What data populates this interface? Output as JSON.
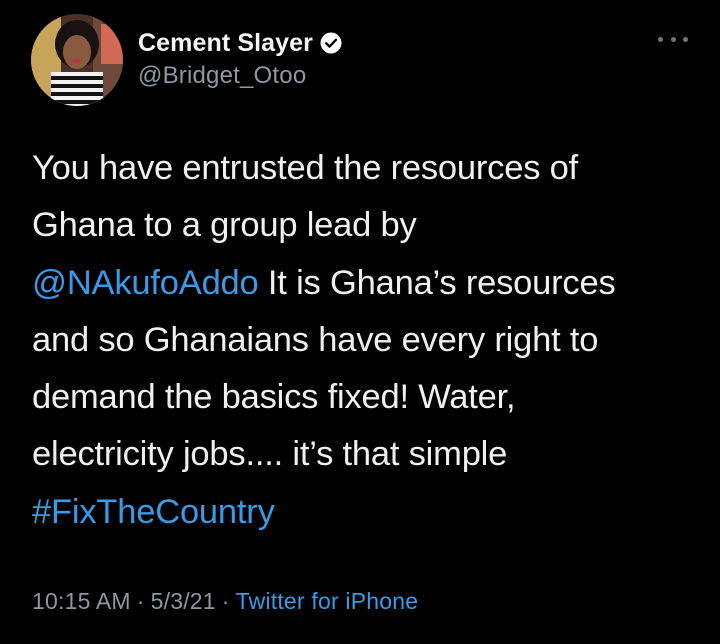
{
  "author": {
    "display_name": "Cement Slayer",
    "handle": "@Bridget_Otoo",
    "verified": true
  },
  "icons": {
    "verified": "verified-badge-icon",
    "more": "more-options-icon"
  },
  "tweet": {
    "lines": [
      [
        {
          "text": "You have entrusted the resources of",
          "link": false
        }
      ],
      [
        {
          "text": "Ghana to a group lead by",
          "link": false
        }
      ],
      [
        {
          "text": "@NAkufoAddo",
          "link": true
        },
        {
          "text": " It is Ghana’s resources",
          "link": false
        }
      ],
      [
        {
          "text": "and so Ghanaians have every right to",
          "link": false
        }
      ],
      [
        {
          "text": "demand the basics fixed! Water,",
          "link": false
        }
      ],
      [
        {
          "text": "electricity jobs.... it’s that simple",
          "link": false
        }
      ],
      [
        {
          "text": "#FixTheCountry",
          "link": true
        }
      ]
    ]
  },
  "meta": {
    "time": "10:15 AM",
    "date": "5/3/21",
    "separator": "·",
    "source": "Twitter for iPhone"
  },
  "colors": {
    "background": "#000000",
    "text": "#f0f0f0",
    "secondary": "#8b98a5",
    "link": "#3a9ae8"
  }
}
